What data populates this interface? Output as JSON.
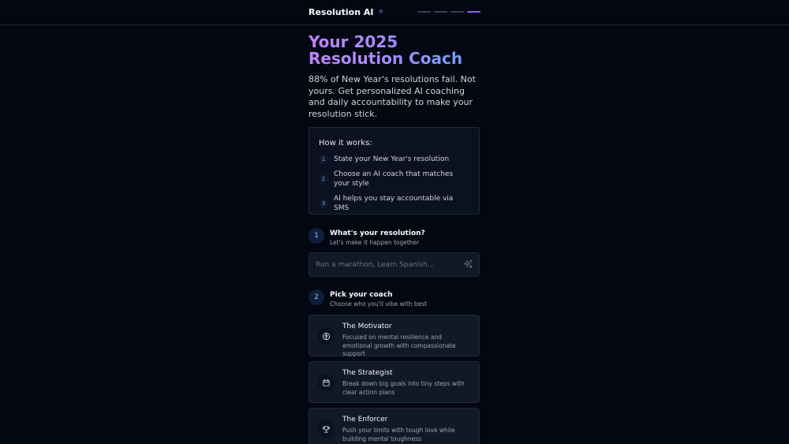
{
  "header": {
    "brand": "Resolution AI",
    "progress_steps": 4,
    "progress_active_step": 4
  },
  "hero": {
    "title_line1": "Your 2025",
    "title_line2": "Resolution Coach",
    "subtitle": "88% of New Year's resolutions fail. Not yours. Get personalized AI coaching and daily accountability to make your resolution stick.",
    "gradient": [
      "#c084fc",
      "#60a5fa"
    ]
  },
  "how_it_works": {
    "title": "How it works:",
    "items": [
      {
        "num": "1",
        "text": "State your New Year's resolution"
      },
      {
        "num": "2",
        "text": "Choose an AI coach that matches your style"
      },
      {
        "num": "3",
        "text": "AI helps you stay accountable via SMS"
      }
    ]
  },
  "step1": {
    "num": "1",
    "title": "What's your resolution?",
    "subtitle": "Let's make it happen together",
    "input_placeholder": "Run a marathon, Learn Spanish...",
    "input_value": "",
    "input_icon": "sparkles-icon"
  },
  "step2": {
    "num": "2",
    "title": "Pick your coach",
    "subtitle": "Choose who you'll vibe with best"
  },
  "coaches": [
    {
      "title": "The Motivator",
      "desc": "Focused on mental resilience and emotional growth with compassionate support",
      "icon": "brain-icon"
    },
    {
      "title": "The Strategist",
      "desc": "Break down big goals into tiny steps with clear action plans",
      "icon": "calendar-icon"
    },
    {
      "title": "The Enforcer",
      "desc": "Push your limits with tough love while building mental toughness",
      "icon": "trophy-icon"
    }
  ],
  "colors": {
    "background": "#030712",
    "accent": "#8b5cf6",
    "card": "#111827",
    "border": "#1f2937"
  }
}
